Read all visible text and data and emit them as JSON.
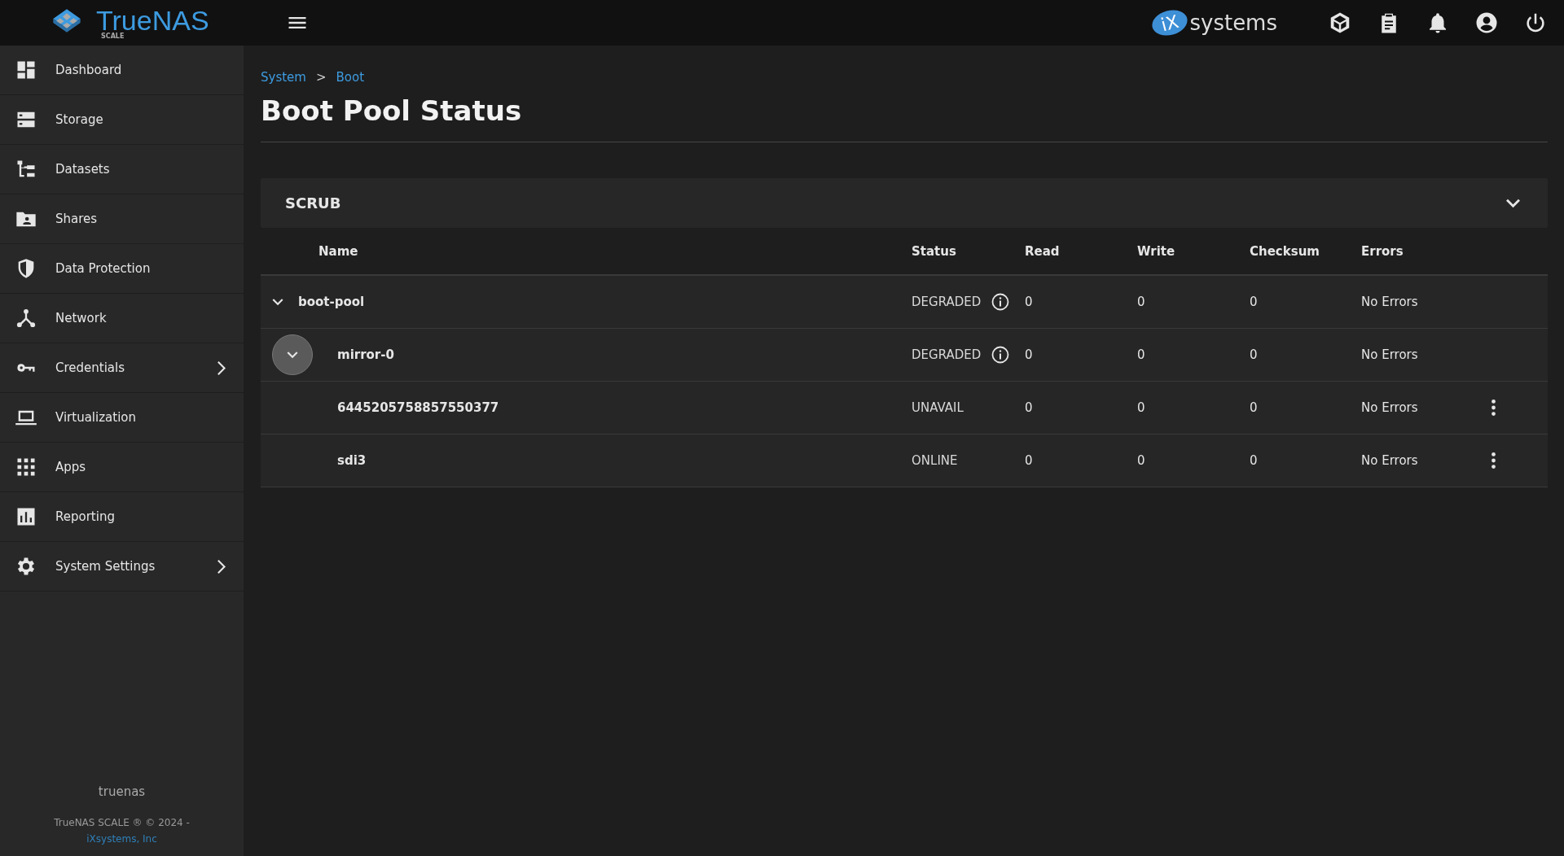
{
  "topbar": {
    "logo_text": "TrueNAS",
    "logo_sub": "SCALE",
    "brand": "systems",
    "brand_mark": "iX"
  },
  "sidebar": {
    "items": [
      {
        "label": "Dashboard",
        "has_submenu": false
      },
      {
        "label": "Storage",
        "has_submenu": false
      },
      {
        "label": "Datasets",
        "has_submenu": false
      },
      {
        "label": "Shares",
        "has_submenu": false
      },
      {
        "label": "Data Protection",
        "has_submenu": false
      },
      {
        "label": "Network",
        "has_submenu": false
      },
      {
        "label": "Credentials",
        "has_submenu": true
      },
      {
        "label": "Virtualization",
        "has_submenu": false
      },
      {
        "label": "Apps",
        "has_submenu": false
      },
      {
        "label": "Reporting",
        "has_submenu": false
      },
      {
        "label": "System Settings",
        "has_submenu": true
      }
    ],
    "hostname": "truenas",
    "copyright": "TrueNAS SCALE ® © 2024 -",
    "company_link": "iXsystems, Inc"
  },
  "breadcrumb": [
    {
      "kind": "link",
      "text": "System"
    },
    {
      "kind": "separator",
      "text": ">"
    },
    {
      "kind": "link",
      "text": "Boot"
    }
  ],
  "page_title": "Boot Pool Status",
  "panel": {
    "title": "SCRUB",
    "expanded": false
  },
  "table": {
    "columns": [
      "Name",
      "Status",
      "Read",
      "Write",
      "Checksum",
      "Errors"
    ],
    "rows": [
      {
        "name": "boot-pool",
        "status": "DEGRADED",
        "status_info": true,
        "read": "0",
        "write": "0",
        "checksum": "0",
        "errors": "No Errors",
        "has_menu": false,
        "expanded": true,
        "focused": false,
        "children": [
          {
            "name": "mirror-0",
            "status": "DEGRADED",
            "status_info": true,
            "read": "0",
            "write": "0",
            "checksum": "0",
            "errors": "No Errors",
            "has_menu": false,
            "expanded": true,
            "focused": true,
            "children": [
              {
                "name": "6445205758857550377",
                "status": "UNAVAIL",
                "status_info": false,
                "read": "0",
                "write": "0",
                "checksum": "0",
                "errors": "No Errors",
                "has_menu": true
              },
              {
                "name": "sdi3",
                "status": "ONLINE",
                "status_info": false,
                "read": "0",
                "write": "0",
                "checksum": "0",
                "errors": "No Errors",
                "has_menu": true
              }
            ]
          }
        ]
      }
    ]
  }
}
